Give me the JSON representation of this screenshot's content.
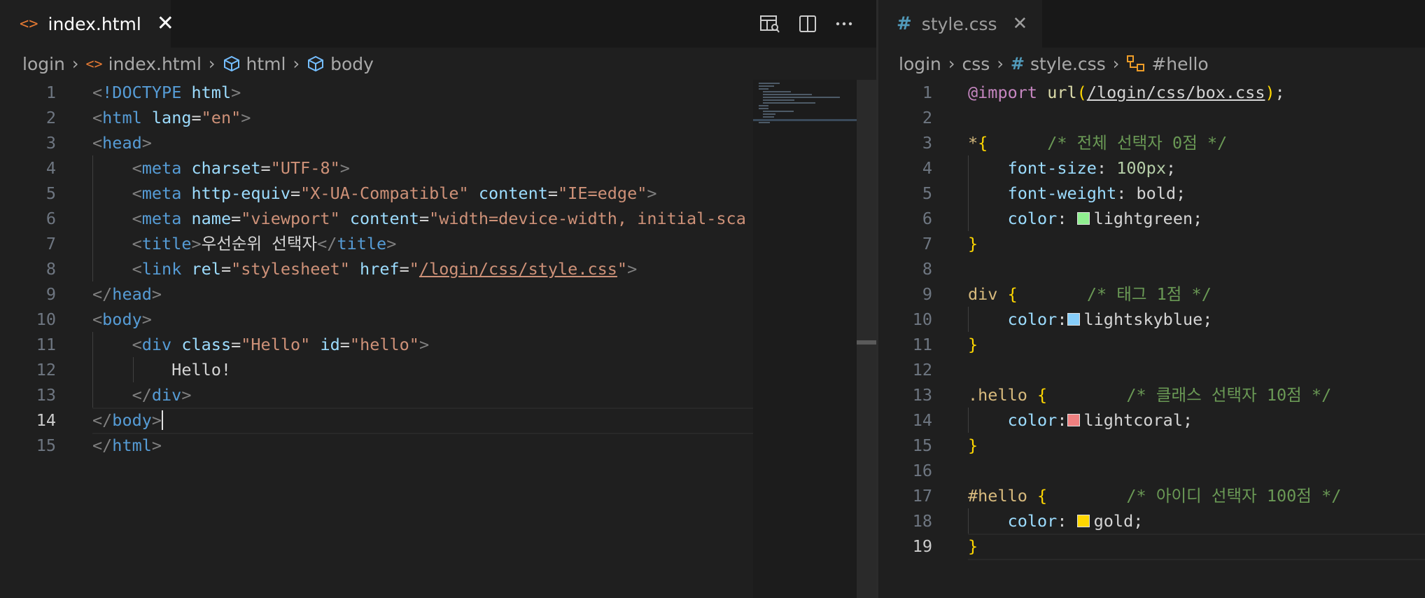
{
  "left": {
    "tab": {
      "label": "index.html",
      "icon": "html-file-icon"
    },
    "toolbar": [
      "open-preview-icon",
      "split-editor-icon",
      "more-actions-icon"
    ],
    "breadcrumb": [
      "login",
      "index.html",
      "html",
      "body"
    ],
    "active_line": 14,
    "lines": [
      [
        [
          "p",
          "<"
        ],
        [
          "tag",
          "!DOCTYPE"
        ],
        [
          "p",
          " "
        ],
        [
          "attr",
          "html"
        ],
        [
          "p",
          ">"
        ]
      ],
      [
        [
          "p",
          "<"
        ],
        [
          "tag",
          "html"
        ],
        [
          "p",
          " "
        ],
        [
          "attr",
          "lang"
        ],
        [
          "txt",
          "="
        ],
        [
          "str",
          "\"en\""
        ],
        [
          "p",
          ">"
        ]
      ],
      [
        [
          "p",
          "<"
        ],
        [
          "tag",
          "head"
        ],
        [
          "p",
          ">"
        ]
      ],
      [
        [
          "p",
          "    <"
        ],
        [
          "tag",
          "meta"
        ],
        [
          "p",
          " "
        ],
        [
          "attr",
          "charset"
        ],
        [
          "txt",
          "="
        ],
        [
          "str",
          "\"UTF-8\""
        ],
        [
          "p",
          ">"
        ]
      ],
      [
        [
          "p",
          "    <"
        ],
        [
          "tag",
          "meta"
        ],
        [
          "p",
          " "
        ],
        [
          "attr",
          "http-equiv"
        ],
        [
          "txt",
          "="
        ],
        [
          "str",
          "\"X-UA-Compatible\""
        ],
        [
          "p",
          " "
        ],
        [
          "attr",
          "content"
        ],
        [
          "txt",
          "="
        ],
        [
          "str",
          "\"IE=edge\""
        ],
        [
          "p",
          ">"
        ]
      ],
      [
        [
          "p",
          "    <"
        ],
        [
          "tag",
          "meta"
        ],
        [
          "p",
          " "
        ],
        [
          "attr",
          "name"
        ],
        [
          "txt",
          "="
        ],
        [
          "str",
          "\"viewport\""
        ],
        [
          "p",
          " "
        ],
        [
          "attr",
          "content"
        ],
        [
          "txt",
          "="
        ],
        [
          "str",
          "\"width=device-width, initial-sca"
        ]
      ],
      [
        [
          "p",
          "    <"
        ],
        [
          "tag",
          "title"
        ],
        [
          "p",
          ">"
        ],
        [
          "txt",
          "우선순위 선택자"
        ],
        [
          "p",
          "</"
        ],
        [
          "tag",
          "title"
        ],
        [
          "p",
          ">"
        ]
      ],
      [
        [
          "p",
          "    <"
        ],
        [
          "tag",
          "link"
        ],
        [
          "p",
          " "
        ],
        [
          "attr",
          "rel"
        ],
        [
          "txt",
          "="
        ],
        [
          "str",
          "\"stylesheet\""
        ],
        [
          "p",
          " "
        ],
        [
          "attr",
          "href"
        ],
        [
          "txt",
          "="
        ],
        [
          "str",
          "\""
        ],
        [
          "strlink",
          "/login/css/style.css"
        ],
        [
          "str",
          "\""
        ],
        [
          "p",
          ">"
        ]
      ],
      [
        [
          "p",
          "</"
        ],
        [
          "tag",
          "head"
        ],
        [
          "p",
          ">"
        ]
      ],
      [
        [
          "p",
          "<"
        ],
        [
          "tag",
          "body"
        ],
        [
          "p",
          ">"
        ]
      ],
      [
        [
          "p",
          "    <"
        ],
        [
          "tag",
          "div"
        ],
        [
          "p",
          " "
        ],
        [
          "attr",
          "class"
        ],
        [
          "txt",
          "="
        ],
        [
          "str",
          "\"Hello\""
        ],
        [
          "p",
          " "
        ],
        [
          "attr",
          "id"
        ],
        [
          "txt",
          "="
        ],
        [
          "str",
          "\"hello\""
        ],
        [
          "p",
          ">"
        ]
      ],
      [
        [
          "txt",
          "        Hello!"
        ]
      ],
      [
        [
          "p",
          "    </"
        ],
        [
          "tag",
          "div"
        ],
        [
          "p",
          ">"
        ]
      ],
      [
        [
          "p",
          "</"
        ],
        [
          "tag",
          "body"
        ],
        [
          "p",
          ">"
        ]
      ],
      [
        [
          "p",
          "</"
        ],
        [
          "tag",
          "html"
        ],
        [
          "p",
          ">"
        ]
      ]
    ]
  },
  "right": {
    "tab": {
      "label": "style.css",
      "icon": "css-hash-icon"
    },
    "breadcrumb": [
      "login",
      "css",
      "style.css",
      "#hello"
    ],
    "active_line": 19,
    "lines": [
      [
        [
          "at",
          "@import"
        ],
        [
          "txt",
          " "
        ],
        [
          "fn",
          "url"
        ],
        [
          "brace",
          "("
        ],
        [
          "link",
          "/login/css/box.css"
        ],
        [
          "brace",
          ")"
        ],
        [
          "txt",
          ";"
        ]
      ],
      [],
      [
        [
          "sel",
          "*"
        ],
        [
          "brace",
          "{"
        ],
        [
          "txt",
          "      "
        ],
        [
          "com",
          "/* 전체 선택자 0점 */"
        ]
      ],
      [
        [
          "txt",
          "    "
        ],
        [
          "attr",
          "font-size"
        ],
        [
          "txt",
          ": "
        ],
        [
          "num",
          "100px"
        ],
        [
          "txt",
          ";"
        ]
      ],
      [
        [
          "txt",
          "    "
        ],
        [
          "attr",
          "font-weight"
        ],
        [
          "txt",
          ": bold;"
        ]
      ],
      [
        [
          "txt",
          "    "
        ],
        [
          "attr",
          "color"
        ],
        [
          "txt",
          ": "
        ],
        [
          "swatch",
          "#90ee90"
        ],
        [
          "txt",
          "lightgreen;"
        ]
      ],
      [
        [
          "brace",
          "}"
        ]
      ],
      [],
      [
        [
          "sel",
          "div"
        ],
        [
          "txt",
          " "
        ],
        [
          "brace",
          "{"
        ],
        [
          "txt",
          "       "
        ],
        [
          "com",
          "/* 태그 1점 */"
        ]
      ],
      [
        [
          "txt",
          "    "
        ],
        [
          "attr",
          "color"
        ],
        [
          "txt",
          ":"
        ],
        [
          "swatch",
          "#87cefa"
        ],
        [
          "txt",
          "lightskyblue;"
        ]
      ],
      [
        [
          "brace",
          "}"
        ]
      ],
      [],
      [
        [
          "sel",
          ".hello"
        ],
        [
          "txt",
          " "
        ],
        [
          "brace",
          "{"
        ],
        [
          "txt",
          "        "
        ],
        [
          "com",
          "/* 클래스 선택자 10점 */"
        ]
      ],
      [
        [
          "txt",
          "    "
        ],
        [
          "attr",
          "color"
        ],
        [
          "txt",
          ":"
        ],
        [
          "swatch",
          "#f08080"
        ],
        [
          "txt",
          "lightcoral;"
        ]
      ],
      [
        [
          "brace",
          "}"
        ]
      ],
      [],
      [
        [
          "sel",
          "#hello"
        ],
        [
          "txt",
          " "
        ],
        [
          "brace",
          "{"
        ],
        [
          "txt",
          "        "
        ],
        [
          "com",
          "/* 아이디 선택자 100점 */"
        ]
      ],
      [
        [
          "txt",
          "    "
        ],
        [
          "attr",
          "color"
        ],
        [
          "txt",
          ": "
        ],
        [
          "swatch",
          "#ffd700"
        ],
        [
          "txt",
          "gold;"
        ]
      ],
      [
        [
          "brace",
          "}"
        ]
      ]
    ]
  }
}
